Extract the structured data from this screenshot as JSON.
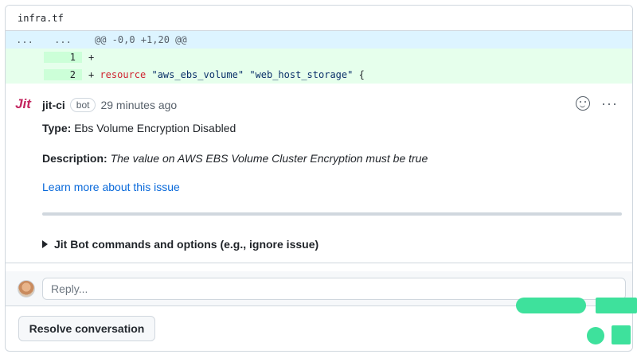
{
  "file": {
    "name": "infra.tf"
  },
  "diff": {
    "hunk": {
      "left_num": "...",
      "right_num": "...",
      "text": "@@ -0,0 +1,20 @@"
    },
    "lines": [
      {
        "num": "1",
        "prefix": "+",
        "keyword": "",
        "str1": "",
        "str2": "",
        "tail": ""
      },
      {
        "num": "2",
        "prefix": "+ ",
        "keyword": "resource",
        "str1": "\"aws_ebs_volume\"",
        "str2": "\"web_host_storage\"",
        "tail": "{"
      }
    ]
  },
  "comment": {
    "avatar_text": "Jit",
    "author": "jit-ci",
    "badge": "bot",
    "time": "29 minutes ago",
    "type_label": "Type:",
    "type_value": "Ebs Volume Encryption Disabled",
    "desc_label": "Description:",
    "desc_value": "The value on AWS EBS Volume Cluster Encryption must be true",
    "link_text": "Learn more about this issue",
    "details_label": "Jit Bot commands and options (e.g., ignore issue)",
    "more_icon": "···"
  },
  "reply": {
    "placeholder": "Reply..."
  },
  "actions": {
    "resolve_label": "Resolve conversation"
  },
  "colors": {
    "accent": "#0969da",
    "add_bg": "#e6ffec",
    "hunk_bg": "#ddf4ff",
    "jit_brand": "#c3255f",
    "deco_green": "#3ee19c"
  }
}
